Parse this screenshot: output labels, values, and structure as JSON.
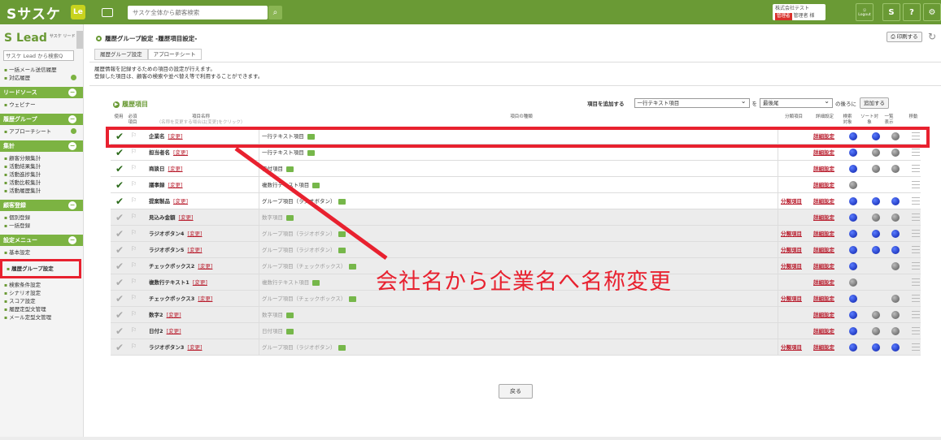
{
  "topbar": {
    "logo": "Sサスケ",
    "le_badge": "Le",
    "search_placeholder": "サスケ全体から顧客検索",
    "company_line1": "株式会社テスト",
    "company_admin": "管理者",
    "company_user": "管理者 様",
    "logout_label": "Logout",
    "help_label": "?",
    "sasuke_label": "S"
  },
  "sidebar": {
    "logo_text": "Lead",
    "logo_sub": "サスケ リード",
    "search_text": "サスケ Lead から検索Q",
    "items_top": [
      "一括メール送信履歴",
      "対応履歴"
    ],
    "sections": [
      {
        "title": "リードソース",
        "items": [
          "ウェビナー"
        ]
      },
      {
        "title": "履歴グループ",
        "items": [
          "アプローチシート"
        ]
      },
      {
        "title": "集計",
        "items": [
          "顧客分類集計",
          "活動結果集計",
          "活動進捗集計",
          "活動比較集計",
          "活動履歴集計"
        ]
      },
      {
        "title": "顧客登録",
        "items": [
          "個別登録",
          "一括登録"
        ]
      },
      {
        "title": "設定メニュー",
        "items": [
          "基本設定"
        ]
      }
    ],
    "highlight_item": "履歴グループ設定",
    "items_bottom": [
      "検索条件設定",
      "シナリオ設定",
      "スコア設定",
      "履歴定型文管理",
      "メール定型文管理"
    ]
  },
  "main": {
    "title": "履歴グループ設定 -履歴項目設定-",
    "print_label": "印刷する",
    "crumbs": [
      "履歴グループ設定",
      "アプローチシート"
    ],
    "desc_line1": "履歴情報を記録するための項目の設定が行えます。",
    "desc_line2": "登録した項目は、顧客の検索や並べ替え等で利用することができます。",
    "section_title": "履歴項目",
    "add_label": "項目を追加する",
    "add_type": "一行テキスト項目",
    "add_wo": "を",
    "add_position": "最後尾",
    "add_after": "の後ろに",
    "add_button": "追加する",
    "back_button": "戻る"
  },
  "table": {
    "headers": {
      "use": "使用",
      "required": "必須項目",
      "name": "項目名称",
      "name_sub": "（名称を変更する場合は[変更]をクリック）",
      "type": "項目の種類",
      "category": "分類項目",
      "detail": "詳細設定",
      "search": "検索対象",
      "sort": "ソート対象",
      "list": "一覧表示",
      "move": "移動"
    },
    "change_label": "[変更]",
    "category_label": "分類項目",
    "detail_label": "詳細設定",
    "rows": [
      {
        "name": "企業名",
        "type": "一行テキスト項目",
        "enabled": true,
        "category": false,
        "search": "blue",
        "sort": "blue",
        "list": "gray"
      },
      {
        "name": "担当者名",
        "type": "一行テキスト項目",
        "enabled": true,
        "category": false,
        "search": "blue",
        "sort": "gray",
        "list": "gray"
      },
      {
        "name": "商談日",
        "type": "日付項目",
        "enabled": true,
        "category": false,
        "search": "blue",
        "sort": "gray",
        "list": "gray"
      },
      {
        "name": "議事録",
        "type": "複数行テキスト項目",
        "enabled": true,
        "category": false,
        "search": "gray",
        "sort": "",
        "list": ""
      },
      {
        "name": "提案製品",
        "type": "グループ項目（ラジオボタン）",
        "enabled": true,
        "category": true,
        "search": "blue",
        "sort": "blue",
        "list": "blue"
      },
      {
        "name": "見込み金額",
        "type": "数字項目",
        "enabled": false,
        "category": false,
        "search": "blue",
        "sort": "gray",
        "list": "gray"
      },
      {
        "name": "ラジオボタン4",
        "type": "グループ項目（ラジオボタン）",
        "enabled": false,
        "category": true,
        "search": "blue",
        "sort": "blue",
        "list": "blue"
      },
      {
        "name": "ラジオボタン5",
        "type": "グループ項目（ラジオボタン）",
        "enabled": false,
        "category": true,
        "search": "blue",
        "sort": "blue",
        "list": "blue"
      },
      {
        "name": "チェックボックス2",
        "type": "グループ項目（チェックボックス）",
        "enabled": false,
        "category": true,
        "search": "blue",
        "sort": "",
        "list": "gray"
      },
      {
        "name": "複数行テキスト1",
        "type": "複数行テキスト項目",
        "enabled": false,
        "category": false,
        "search": "gray",
        "sort": "",
        "list": ""
      },
      {
        "name": "チェックボックス3",
        "type": "グループ項目（チェックボックス）",
        "enabled": false,
        "category": true,
        "search": "blue",
        "sort": "",
        "list": "gray"
      },
      {
        "name": "数字2",
        "type": "数字項目",
        "enabled": false,
        "category": false,
        "search": "blue",
        "sort": "gray",
        "list": "gray"
      },
      {
        "name": "日付2",
        "type": "日付項目",
        "enabled": false,
        "category": false,
        "search": "blue",
        "sort": "gray",
        "list": "gray"
      },
      {
        "name": "ラジオボタン3",
        "type": "グループ項目（ラジオボタン）",
        "enabled": false,
        "category": true,
        "search": "blue",
        "sort": "blue",
        "list": "blue"
      }
    ]
  },
  "annotation": {
    "text": "会社名から企業名へ名称変更",
    "color": "#e8212f"
  },
  "colors": {
    "brand": "#6a9a35",
    "link": "#b91f2f",
    "highlight": "#e8212f"
  }
}
